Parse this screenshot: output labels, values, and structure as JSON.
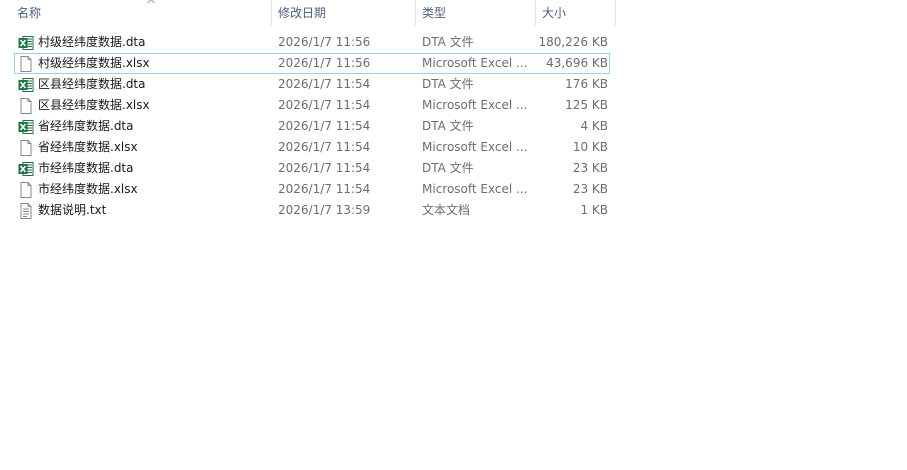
{
  "columns": {
    "name": "名称",
    "date": "修改日期",
    "type": "类型",
    "size": "大小"
  },
  "files": [
    {
      "name": "村级经纬度数据.dta",
      "date": "2026/1/7 11:56",
      "type": "DTA 文件",
      "size": "180,226 KB",
      "icon": "excel-icon",
      "selected": false
    },
    {
      "name": "村级经纬度数据.xlsx",
      "date": "2026/1/7 11:56",
      "type": "Microsoft Excel ...",
      "size": "43,696 KB",
      "icon": "blank-file-icon",
      "selected": true
    },
    {
      "name": "区县经纬度数据.dta",
      "date": "2026/1/7 11:54",
      "type": "DTA 文件",
      "size": "176 KB",
      "icon": "excel-icon",
      "selected": false
    },
    {
      "name": "区县经纬度数据.xlsx",
      "date": "2026/1/7 11:54",
      "type": "Microsoft Excel ...",
      "size": "125 KB",
      "icon": "blank-file-icon",
      "selected": false
    },
    {
      "name": "省经纬度数据.dta",
      "date": "2026/1/7 11:54",
      "type": "DTA 文件",
      "size": "4 KB",
      "icon": "excel-icon",
      "selected": false
    },
    {
      "name": "省经纬度数据.xlsx",
      "date": "2026/1/7 11:54",
      "type": "Microsoft Excel ...",
      "size": "10 KB",
      "icon": "blank-file-icon",
      "selected": false
    },
    {
      "name": "市经纬度数据.dta",
      "date": "2026/1/7 11:54",
      "type": "DTA 文件",
      "size": "23 KB",
      "icon": "excel-icon",
      "selected": false
    },
    {
      "name": "市经纬度数据.xlsx",
      "date": "2026/1/7 11:54",
      "type": "Microsoft Excel ...",
      "size": "23 KB",
      "icon": "blank-file-icon",
      "selected": false
    },
    {
      "name": "数据说明.txt",
      "date": "2026/1/7 13:59",
      "type": "文本文档",
      "size": "1 KB",
      "icon": "text-file-icon",
      "selected": false
    }
  ],
  "colors": {
    "header_text": "#4c607a",
    "selection_border": "#99d1e8",
    "excel_green": "#1e7145"
  }
}
